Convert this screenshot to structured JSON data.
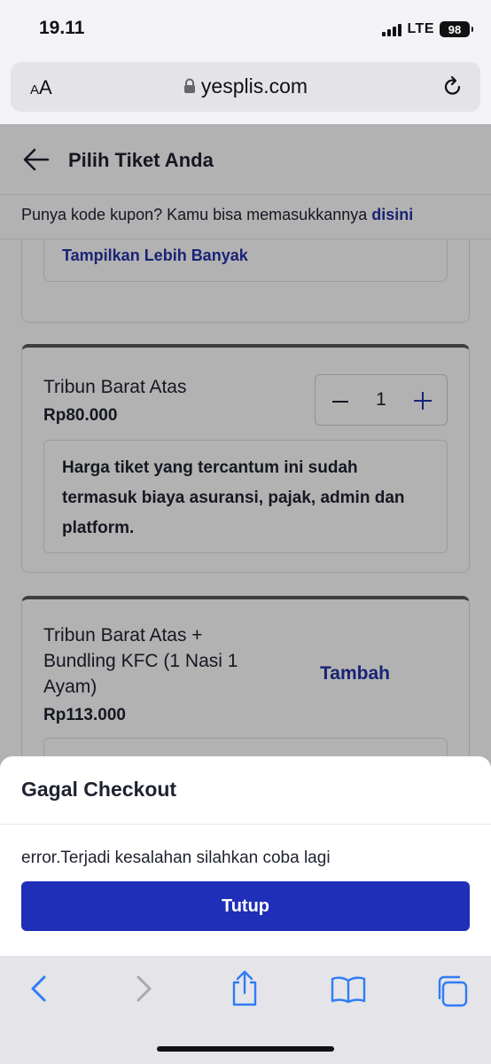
{
  "status_bar": {
    "time": "19.11",
    "network": "LTE",
    "battery": "98"
  },
  "browser": {
    "text_size_label": "AA",
    "url": "yesplis.com"
  },
  "header": {
    "title": "Pilih Tiket Anda"
  },
  "coupon": {
    "text": "Punya kode kupon? Kamu bisa memasukkannya ",
    "link": "disini"
  },
  "tickets": {
    "previous": {
      "show_more": "Tampilkan Lebih Banyak"
    },
    "items": [
      {
        "name": "Tribun Barat Atas",
        "price": "Rp80.000",
        "quantity": "1",
        "note": "Harga tiket yang tercantum ini sudah termasuk biaya asuransi, pajak, admin dan platform."
      },
      {
        "name": "Tribun Barat Atas + Bundling KFC (1 Nasi 1 Ayam)",
        "price": "Rp113.000",
        "action": "Tambah"
      }
    ]
  },
  "dialog": {
    "title": "Gagal Checkout",
    "message": "error.Terjadi kesalahan silahkan coba lagi",
    "button": "Tutup"
  },
  "colors": {
    "accent": "#2433a8",
    "button": "#1f2fb8"
  }
}
